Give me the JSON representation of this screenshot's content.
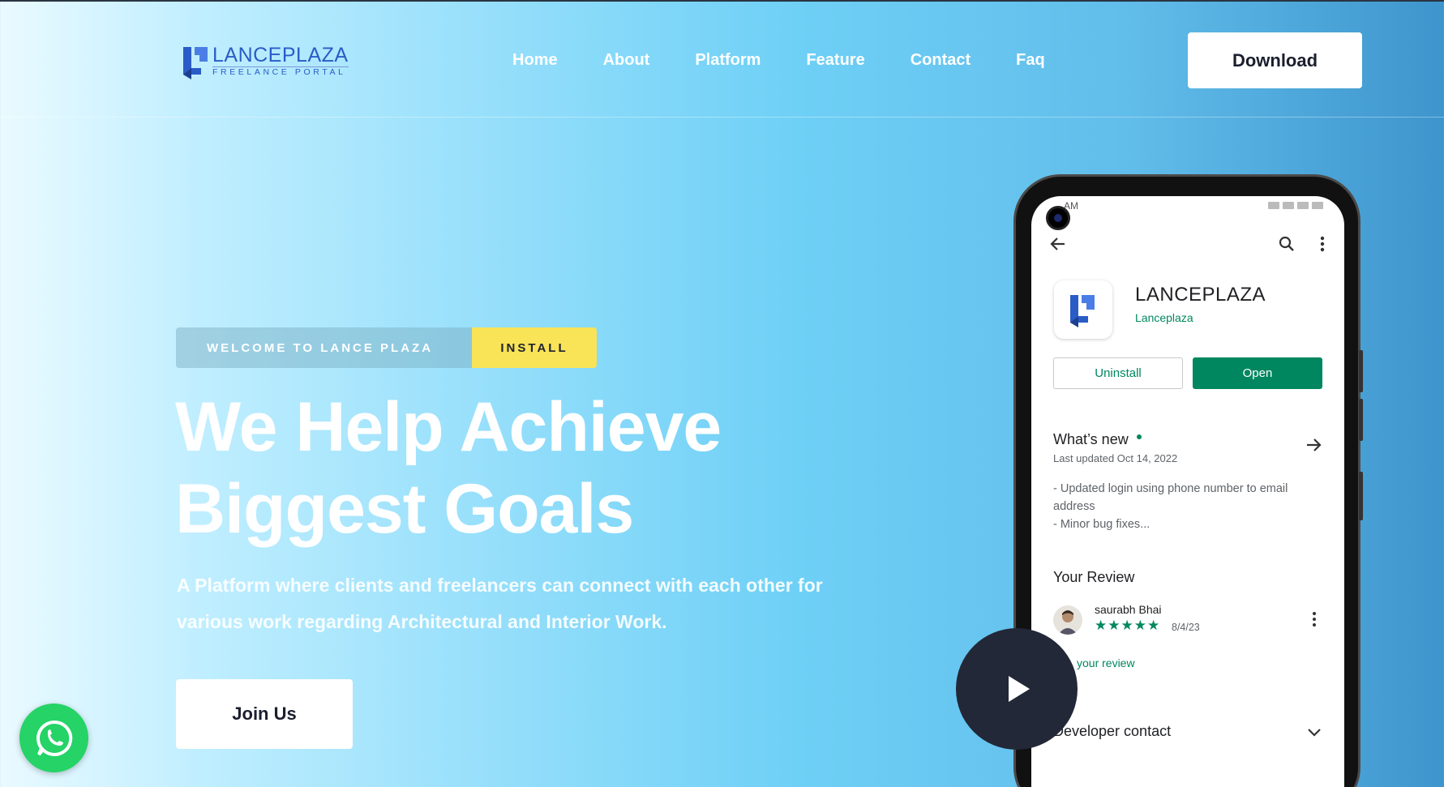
{
  "brand": {
    "name": "LANCEPLAZA",
    "tagline": "FREELANCE PORTAL",
    "color": "#2a5cc7"
  },
  "nav": {
    "items": [
      {
        "label": "Home"
      },
      {
        "label": "About"
      },
      {
        "label": "Platform"
      },
      {
        "label": "Feature"
      },
      {
        "label": "Contact"
      },
      {
        "label": "Faq"
      }
    ],
    "download_label": "Download"
  },
  "hero": {
    "badge_welcome": "WELCOME TO LANCE PLAZA",
    "badge_install": "INSTALL",
    "title_line1": "We Help Achieve",
    "title_line2": "Biggest Goals",
    "description": "A Platform where clients and freelancers can connect with each other for various work regarding Architectural and Interior Work.",
    "join_label": "Join Us",
    "accent_color": "#f9e356"
  },
  "phone": {
    "status_time": "AM",
    "app_name": "LANCEPLAZA",
    "app_developer": "Lanceplaza",
    "uninstall_label": "Uninstall",
    "open_label": "Open",
    "whats_new_title": "What’s new",
    "last_updated": "Last updated Oct 14, 2022",
    "notes": [
      "- Updated login using phone number to email address",
      "- Minor bug fixes..."
    ],
    "review_section_title": "Your Review",
    "reviewer_name": "saurabh Bhai",
    "review_stars": "★★★★★",
    "review_rating": 5,
    "review_date": "8/4/23",
    "edit_review_label": "your review",
    "developer_contact_label": "Developer contact",
    "play_store_green": "#01875f"
  },
  "icons": {
    "whatsapp": "whatsapp-icon",
    "play": "play-icon",
    "back": "back-arrow-icon",
    "search": "search-icon",
    "menu": "more-vert-icon"
  }
}
